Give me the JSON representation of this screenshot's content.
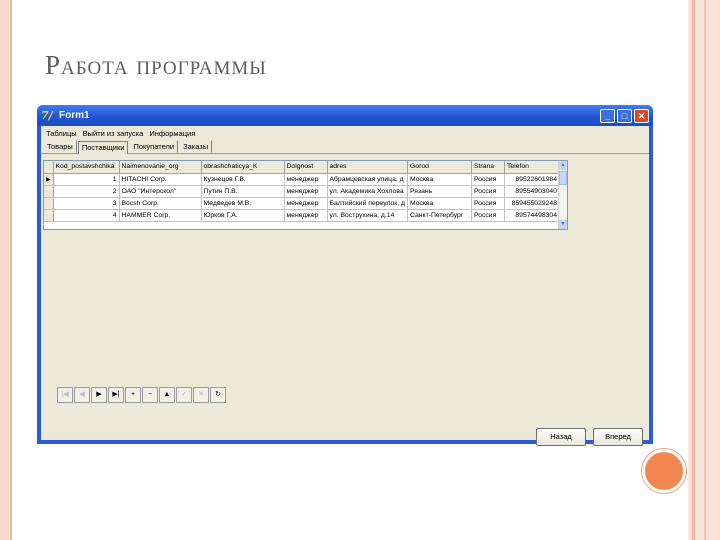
{
  "slide": {
    "title": "Работа программы"
  },
  "window": {
    "title": "Form1",
    "icon": "delphi-app-icon",
    "controls": {
      "minimize": "_",
      "maximize": "□",
      "close": "✕"
    }
  },
  "menu": [
    "Таблицы",
    "Выйти из запуска",
    "Информация"
  ],
  "tabs": [
    "Товары",
    "Поставщики",
    "Покупатели",
    "Заказы"
  ],
  "active_tab": "Поставщики",
  "grid": {
    "columns": [
      "Kod_postavshchika",
      "Naimenovanie_org",
      "obrashchaticya_K",
      "Dolgnost",
      "adres",
      "Gorod",
      "Strana",
      "Telefon"
    ],
    "rows": [
      [
        "1",
        "HITACHI Corp.",
        "Кузнецов Г.В.",
        "менеджер",
        "Абрамцевская улица, д",
        "Москва",
        "Россия",
        "89522601984"
      ],
      [
        "2",
        "ОАО \"Интерскол\"",
        "Путин П.В.",
        "менеджер",
        "ул. Академика Хохлова",
        "Рязань",
        "Россия",
        "89554903040"
      ],
      [
        "3",
        "Bocsh Corp.",
        "Медведев М.В.",
        "менеджер",
        "Балтийский переулок, д",
        "Москва",
        "Россия",
        "859455029248"
      ],
      [
        "4",
        "HAMMER Corp.",
        "Юрков Г.А.",
        "менеджер",
        "ул. Вострухина, д.14",
        "Санкт-Петербург",
        "Россия",
        "89574498304"
      ]
    ],
    "current_row_marker": "▶"
  },
  "navigator": [
    {
      "glyph": "|◀",
      "name": "first-record-button",
      "enabled": false
    },
    {
      "glyph": "◀",
      "name": "prior-record-button",
      "enabled": false
    },
    {
      "glyph": "▶",
      "name": "next-record-button",
      "enabled": true
    },
    {
      "glyph": "▶|",
      "name": "last-record-button",
      "enabled": true
    },
    {
      "glyph": "+",
      "name": "insert-record-button",
      "enabled": true
    },
    {
      "glyph": "−",
      "name": "delete-record-button",
      "enabled": true
    },
    {
      "glyph": "▲",
      "name": "edit-record-button",
      "enabled": true
    },
    {
      "glyph": "✓",
      "name": "post-record-button",
      "enabled": false
    },
    {
      "glyph": "✕",
      "name": "cancel-edit-button",
      "enabled": false
    },
    {
      "glyph": "↻",
      "name": "refresh-button",
      "enabled": true
    }
  ],
  "buttons": {
    "back": "Назад",
    "forward": "Вперед"
  },
  "colors": {
    "titlebar": "#2a5cd8",
    "client": "#ece9d8",
    "accent_dot": "#f4874f"
  }
}
